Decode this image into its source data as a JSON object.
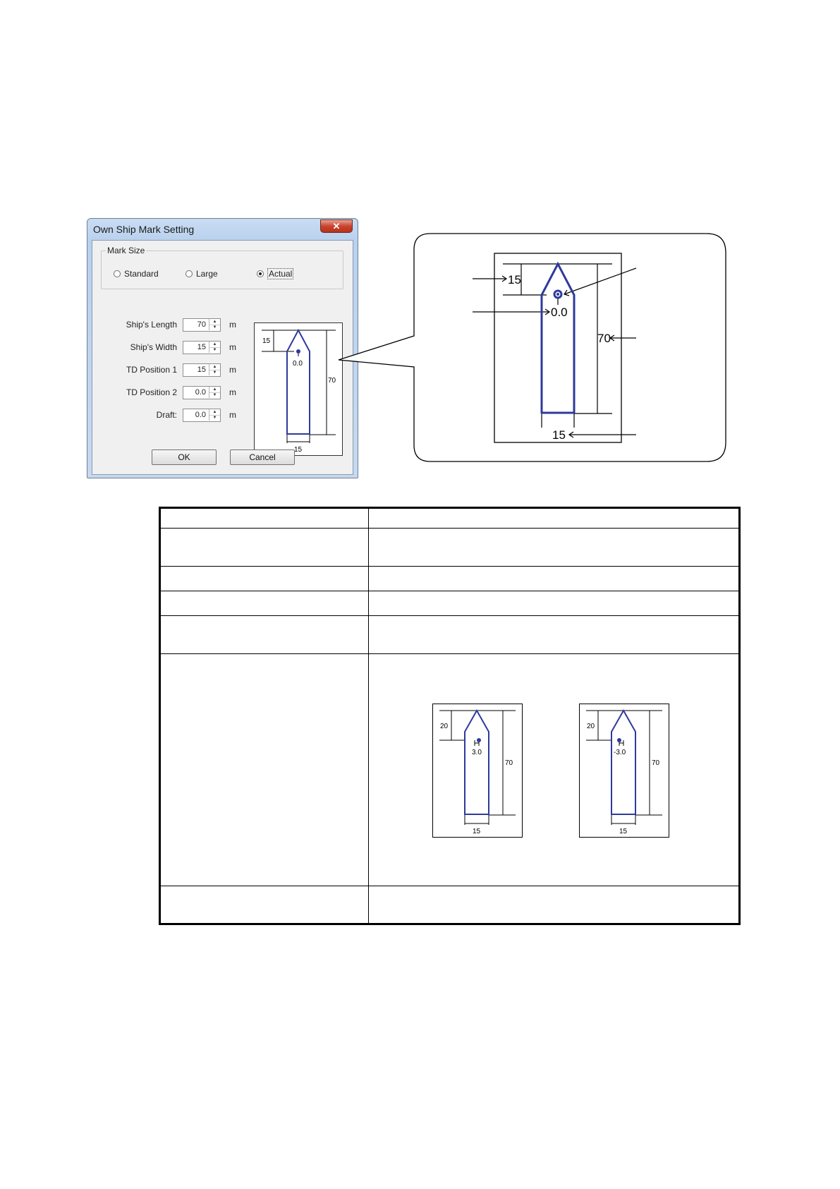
{
  "dialog": {
    "title": "Own Ship Mark Setting",
    "close_glyph": "✕",
    "mark_size": {
      "legend": "Mark Size",
      "options": [
        "Standard",
        "Large",
        "Actual"
      ],
      "selected": "Actual"
    },
    "fields": [
      {
        "label": "Ship's Length",
        "value": "70",
        "unit": "m"
      },
      {
        "label": "Ship's Width",
        "value": "15",
        "unit": "m"
      },
      {
        "label": "TD Position 1",
        "value": "15",
        "unit": "m"
      },
      {
        "label": "TD Position 2",
        "value": "0.0",
        "unit": "m"
      },
      {
        "label": "Draft:",
        "value": "0.0",
        "unit": "m"
      }
    ],
    "preview": {
      "top_dim": "15",
      "pos": "0.0",
      "length_dim": "70",
      "width_dim": "15"
    },
    "ok_label": "OK",
    "cancel_label": "Cancel"
  },
  "callout": {
    "top_dim": "15",
    "pos": "0.0",
    "length_dim": "70",
    "width_dim": "15"
  },
  "table": {
    "examples": [
      {
        "top_dim": "20",
        "pos": "3.0",
        "length_dim": "70",
        "width_dim": "15"
      },
      {
        "top_dim": "20",
        "pos": "-3.0",
        "length_dim": "70",
        "width_dim": "15"
      }
    ]
  },
  "colors": {
    "ship_outline": "#2e3a9c",
    "window_frame": "#b9d1ee",
    "close_button": "#c8452f"
  }
}
